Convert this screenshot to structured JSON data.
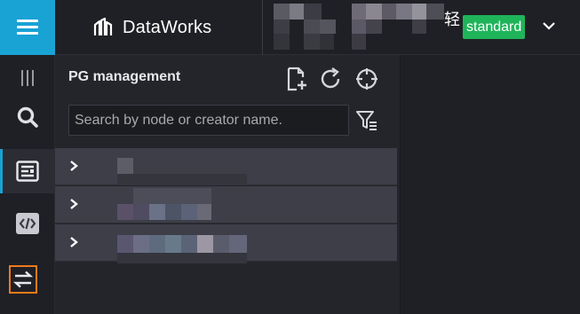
{
  "app": {
    "brand_name": "DataWorks"
  },
  "header": {
    "workspace_char": "轻",
    "environment_badge": "standard"
  },
  "panel": {
    "title": "PG management",
    "search_placeholder": "Search by node or creator name.",
    "rows": [
      {
        "label": ""
      },
      {
        "label": ""
      },
      {
        "label": ""
      }
    ]
  },
  "colors": {
    "accent": "#19a2d4",
    "badge_green": "#1fb45a",
    "highlight_outline": "#ee7a1b"
  },
  "icons": {
    "menu": "hamburger-icon",
    "brand": "dataworks-logo-icon",
    "dropdown": "chevron-down-icon",
    "rail": [
      "collapse-icon",
      "search-icon",
      "list-icon",
      "code-icon",
      "swap-icon"
    ],
    "tools": [
      "new-file-icon",
      "refresh-icon",
      "locate-icon",
      "filter-icon"
    ]
  }
}
